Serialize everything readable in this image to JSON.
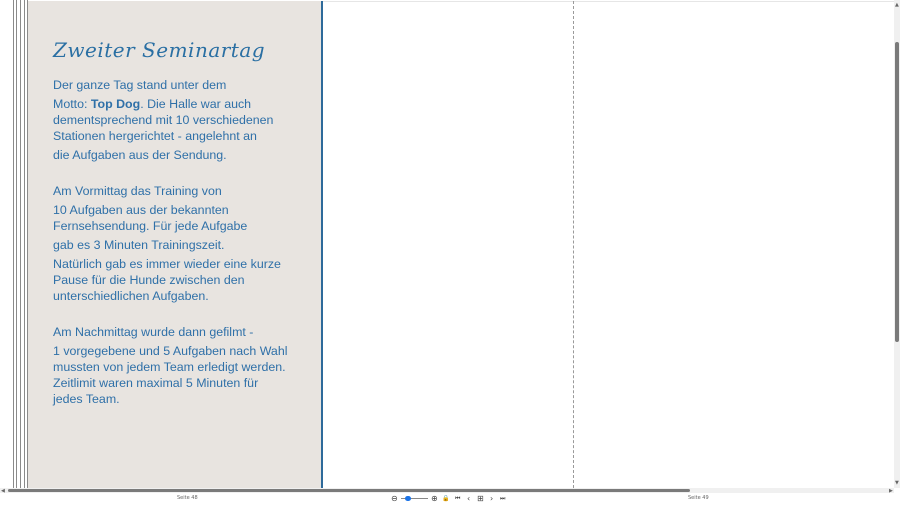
{
  "document": {
    "heading": "Zweiter Seminartag",
    "paragraphs": {
      "p1_l1": "Der ganze Tag stand unter dem",
      "p1_l2_pre": "Motto: ",
      "p1_l2_bold": "Top Dog",
      "p1_l2_post": ". Die Halle war auch",
      "p1_l3": "dementsprechend mit 10 verschiedenen",
      "p1_l4": "Stationen  hergerichtet - angelehnt an",
      "p1_l5": "die Aufgaben aus der Sendung.",
      "p2_l1": "Am Vormittag das Training von",
      "p2_l2": "10 Aufgaben aus der bekannten",
      "p2_l3": "Fernsehsendung. Für jede Aufgabe",
      "p2_l4": "gab es 3 Minuten Trainingszeit.",
      "p2_l5": "Natürlich gab es immer wieder eine kurze",
      "p2_l6": "Pause für die Hunde zwischen den",
      "p2_l7": "unterschiedlichen Aufgaben.",
      "p3_l1": "Am Nachmittag wurde dann gefilmt -",
      "p3_l2": "1 vorgegebene und 5 Aufgaben nach Wahl",
      "p3_l3": "mussten von jedem Team erledigt werden.",
      "p3_l4": "Zeitlimit waren maximal 5 Minuten für",
      "p3_l5": "jedes Team."
    },
    "colors": {
      "text": "#2f70a8",
      "page_bg": "#e8e4e0",
      "accent": "#2e6a9a"
    }
  },
  "statusbar": {
    "left_page_label": "Seite 48",
    "right_page_label": "Seite 49",
    "zoom_out_icon": "⊖",
    "zoom_in_icon": "⊕",
    "zoom_level": 0.2,
    "tools": {
      "lock": "🔒",
      "first": "⏮",
      "prev": "‹",
      "view": "⊞",
      "next": "›",
      "last": "⏭"
    }
  },
  "scrollbars": {
    "up": "▲",
    "down": "▼",
    "left": "◀",
    "right": "▶"
  }
}
